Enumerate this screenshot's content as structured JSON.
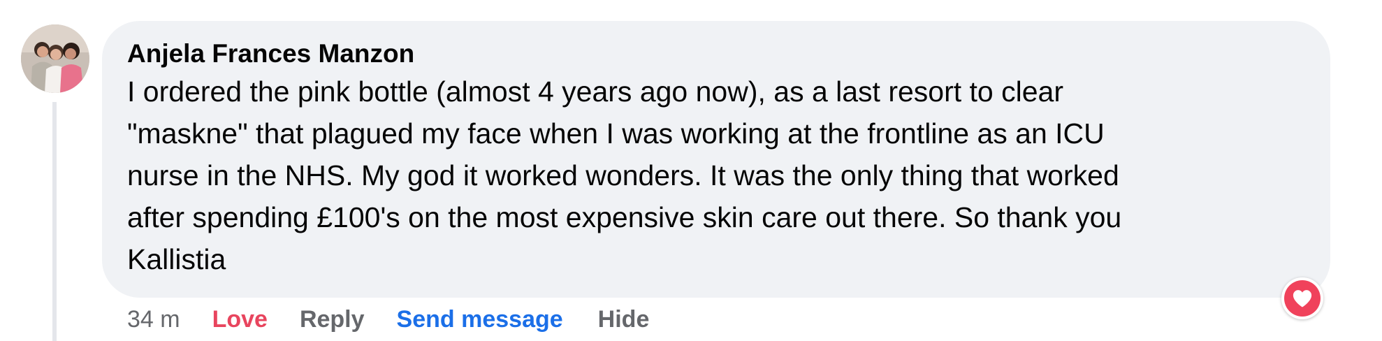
{
  "comment": {
    "author": "Anjela Frances Manzon",
    "text_lines": [
      "I ordered the pink bottle (almost 4 years ago now), as a last resort to clear",
      "\"maskne\" that plagued my face when I was working at the frontline as an ICU",
      "nurse in the NHS. My god it worked wonders. It was the only thing that worked",
      "after spending £100's on the most expensive skin care out there. So thank you",
      "Kallistia"
    ],
    "reaction_icon": "heart-icon",
    "reaction_color": "#f0425b"
  },
  "actions": {
    "timestamp": "34 m",
    "love_label": "Love",
    "reply_label": "Reply",
    "send_message_label": "Send message",
    "hide_label": "Hide",
    "love_color": "#e8455e",
    "send_message_color": "#1b6fe8"
  }
}
